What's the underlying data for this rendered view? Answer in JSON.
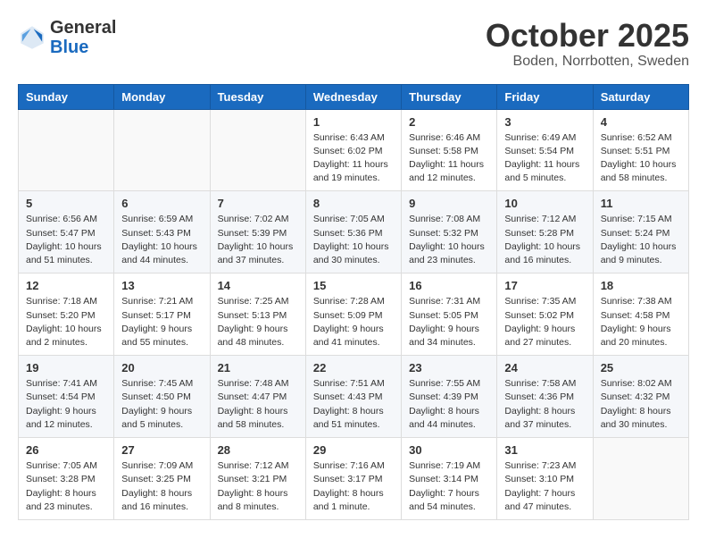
{
  "header": {
    "logo_general": "General",
    "logo_blue": "Blue",
    "month_title": "October 2025",
    "location": "Boden, Norrbotten, Sweden"
  },
  "weekdays": [
    "Sunday",
    "Monday",
    "Tuesday",
    "Wednesday",
    "Thursday",
    "Friday",
    "Saturday"
  ],
  "weeks": [
    [
      {
        "day": "",
        "info": ""
      },
      {
        "day": "",
        "info": ""
      },
      {
        "day": "",
        "info": ""
      },
      {
        "day": "1",
        "info": "Sunrise: 6:43 AM\nSunset: 6:02 PM\nDaylight: 11 hours\nand 19 minutes."
      },
      {
        "day": "2",
        "info": "Sunrise: 6:46 AM\nSunset: 5:58 PM\nDaylight: 11 hours\nand 12 minutes."
      },
      {
        "day": "3",
        "info": "Sunrise: 6:49 AM\nSunset: 5:54 PM\nDaylight: 11 hours\nand 5 minutes."
      },
      {
        "day": "4",
        "info": "Sunrise: 6:52 AM\nSunset: 5:51 PM\nDaylight: 10 hours\nand 58 minutes."
      }
    ],
    [
      {
        "day": "5",
        "info": "Sunrise: 6:56 AM\nSunset: 5:47 PM\nDaylight: 10 hours\nand 51 minutes."
      },
      {
        "day": "6",
        "info": "Sunrise: 6:59 AM\nSunset: 5:43 PM\nDaylight: 10 hours\nand 44 minutes."
      },
      {
        "day": "7",
        "info": "Sunrise: 7:02 AM\nSunset: 5:39 PM\nDaylight: 10 hours\nand 37 minutes."
      },
      {
        "day": "8",
        "info": "Sunrise: 7:05 AM\nSunset: 5:36 PM\nDaylight: 10 hours\nand 30 minutes."
      },
      {
        "day": "9",
        "info": "Sunrise: 7:08 AM\nSunset: 5:32 PM\nDaylight: 10 hours\nand 23 minutes."
      },
      {
        "day": "10",
        "info": "Sunrise: 7:12 AM\nSunset: 5:28 PM\nDaylight: 10 hours\nand 16 minutes."
      },
      {
        "day": "11",
        "info": "Sunrise: 7:15 AM\nSunset: 5:24 PM\nDaylight: 10 hours\nand 9 minutes."
      }
    ],
    [
      {
        "day": "12",
        "info": "Sunrise: 7:18 AM\nSunset: 5:20 PM\nDaylight: 10 hours\nand 2 minutes."
      },
      {
        "day": "13",
        "info": "Sunrise: 7:21 AM\nSunset: 5:17 PM\nDaylight: 9 hours\nand 55 minutes."
      },
      {
        "day": "14",
        "info": "Sunrise: 7:25 AM\nSunset: 5:13 PM\nDaylight: 9 hours\nand 48 minutes."
      },
      {
        "day": "15",
        "info": "Sunrise: 7:28 AM\nSunset: 5:09 PM\nDaylight: 9 hours\nand 41 minutes."
      },
      {
        "day": "16",
        "info": "Sunrise: 7:31 AM\nSunset: 5:05 PM\nDaylight: 9 hours\nand 34 minutes."
      },
      {
        "day": "17",
        "info": "Sunrise: 7:35 AM\nSunset: 5:02 PM\nDaylight: 9 hours\nand 27 minutes."
      },
      {
        "day": "18",
        "info": "Sunrise: 7:38 AM\nSunset: 4:58 PM\nDaylight: 9 hours\nand 20 minutes."
      }
    ],
    [
      {
        "day": "19",
        "info": "Sunrise: 7:41 AM\nSunset: 4:54 PM\nDaylight: 9 hours\nand 12 minutes."
      },
      {
        "day": "20",
        "info": "Sunrise: 7:45 AM\nSunset: 4:50 PM\nDaylight: 9 hours\nand 5 minutes."
      },
      {
        "day": "21",
        "info": "Sunrise: 7:48 AM\nSunset: 4:47 PM\nDaylight: 8 hours\nand 58 minutes."
      },
      {
        "day": "22",
        "info": "Sunrise: 7:51 AM\nSunset: 4:43 PM\nDaylight: 8 hours\nand 51 minutes."
      },
      {
        "day": "23",
        "info": "Sunrise: 7:55 AM\nSunset: 4:39 PM\nDaylight: 8 hours\nand 44 minutes."
      },
      {
        "day": "24",
        "info": "Sunrise: 7:58 AM\nSunset: 4:36 PM\nDaylight: 8 hours\nand 37 minutes."
      },
      {
        "day": "25",
        "info": "Sunrise: 8:02 AM\nSunset: 4:32 PM\nDaylight: 8 hours\nand 30 minutes."
      }
    ],
    [
      {
        "day": "26",
        "info": "Sunrise: 7:05 AM\nSunset: 3:28 PM\nDaylight: 8 hours\nand 23 minutes."
      },
      {
        "day": "27",
        "info": "Sunrise: 7:09 AM\nSunset: 3:25 PM\nDaylight: 8 hours\nand 16 minutes."
      },
      {
        "day": "28",
        "info": "Sunrise: 7:12 AM\nSunset: 3:21 PM\nDaylight: 8 hours\nand 8 minutes."
      },
      {
        "day": "29",
        "info": "Sunrise: 7:16 AM\nSunset: 3:17 PM\nDaylight: 8 hours\nand 1 minute."
      },
      {
        "day": "30",
        "info": "Sunrise: 7:19 AM\nSunset: 3:14 PM\nDaylight: 7 hours\nand 54 minutes."
      },
      {
        "day": "31",
        "info": "Sunrise: 7:23 AM\nSunset: 3:10 PM\nDaylight: 7 hours\nand 47 minutes."
      },
      {
        "day": "",
        "info": ""
      }
    ]
  ]
}
